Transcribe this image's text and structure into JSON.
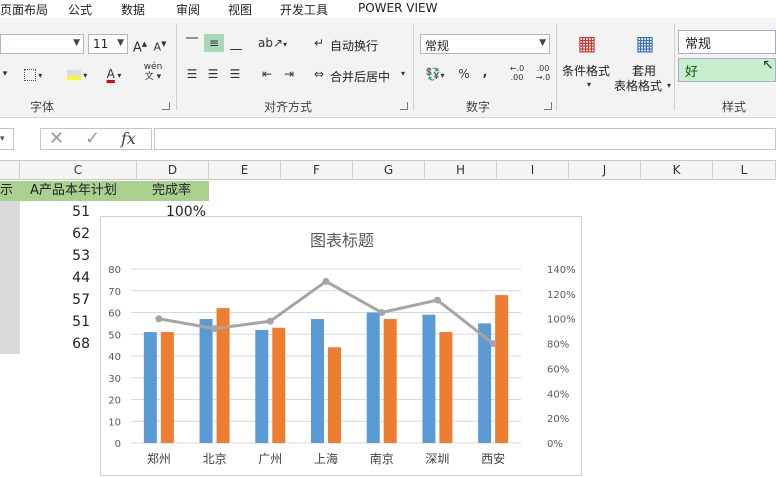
{
  "menu": [
    "页面布局",
    "公式",
    "数据",
    "审阅",
    "视图",
    "开发工具",
    "POWER VIEW"
  ],
  "ribbon": {
    "font_size": "11",
    "font_group_label": "字体",
    "align_group_label": "对齐方式",
    "number_group_label": "数字",
    "style_group_label": "样式",
    "wrap_text": "自动换行",
    "merge_center": "合并后居中",
    "number_format": "常规",
    "cond_format": "条件格式",
    "table_format_1": "套用",
    "table_format_2": "表格格式",
    "style_normal": "常规",
    "style_good": "好",
    "percent": "%",
    "comma": ",",
    "inc_dec": "←.0 .00",
    "dec_dec": ".00 →.0"
  },
  "formula_bar": {
    "fx": "fx"
  },
  "columns": [
    "C",
    "D",
    "E",
    "F",
    "G",
    "H",
    "I",
    "J",
    "K",
    "L"
  ],
  "sheet": {
    "header_b_partial": "示",
    "header_c": "A产品本年计划",
    "header_d": "完成率",
    "c_values": [
      "51",
      "62",
      "53",
      "44",
      "57",
      "51",
      "68"
    ],
    "d_first": "100%"
  },
  "colors": {
    "blue": "#5b9bd5",
    "orange": "#ed7d31",
    "gray": "#a5a5a5",
    "green_header": "#a9d08e",
    "style_good_bg": "#c6efce"
  },
  "chart_data": {
    "type": "bar",
    "title": "图表标题",
    "categories": [
      "郑州",
      "北京",
      "广州",
      "上海",
      "南京",
      "深圳",
      "西安"
    ],
    "series": [
      {
        "type": "bar",
        "values": [
          51,
          57,
          52,
          57,
          60,
          59,
          55
        ]
      },
      {
        "type": "bar",
        "values": [
          51,
          62,
          53,
          44,
          57,
          51,
          68
        ]
      },
      {
        "type": "line",
        "axis": "secondary",
        "values": [
          100,
          92,
          98,
          130,
          105,
          115,
          80
        ]
      }
    ],
    "ylim": [
      0,
      80
    ],
    "yticks": [
      "0",
      "10",
      "20",
      "30",
      "40",
      "50",
      "60",
      "70",
      "80"
    ],
    "y2lim": [
      0,
      140
    ],
    "y2ticks": [
      "0%",
      "20%",
      "40%",
      "60%",
      "80%",
      "100%",
      "120%",
      "140%"
    ],
    "grid": true,
    "legend": "none"
  }
}
